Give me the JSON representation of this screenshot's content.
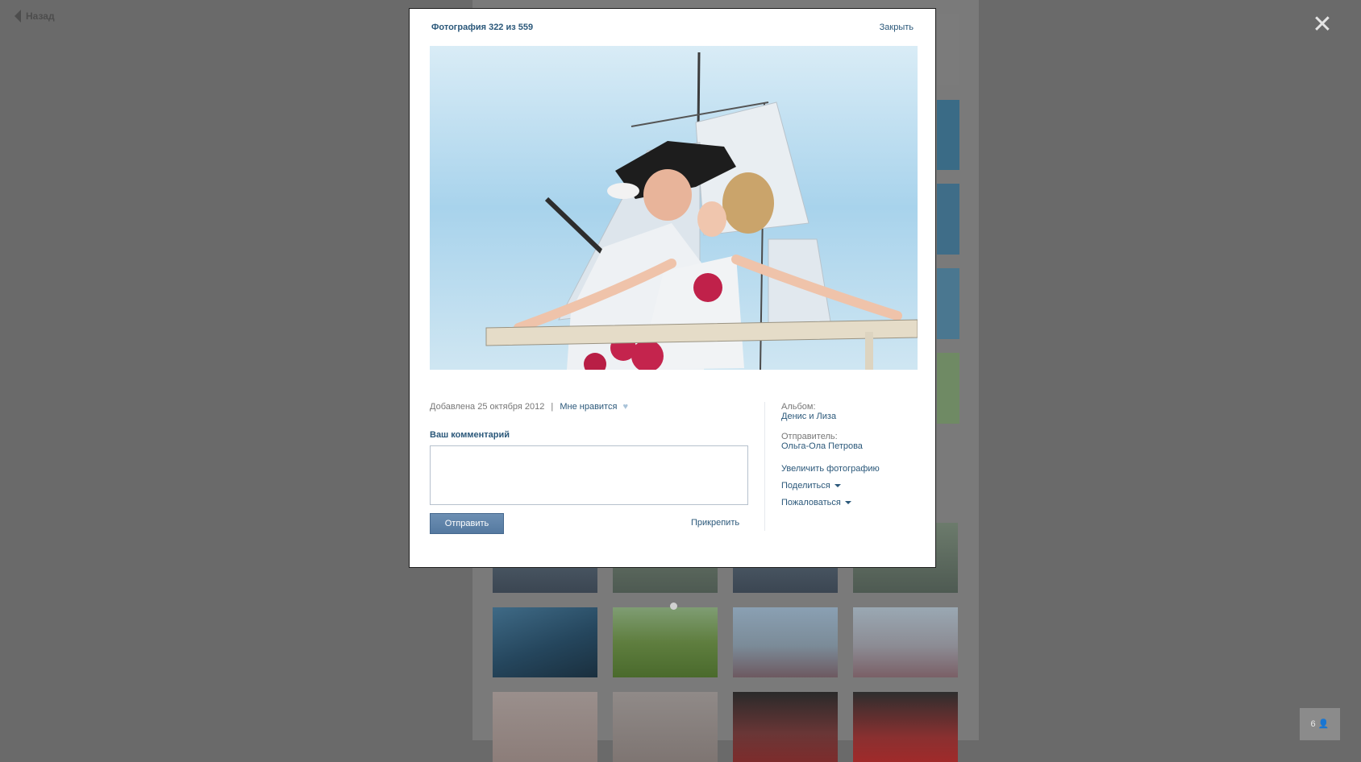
{
  "nav": {
    "back_label": "Назад"
  },
  "modal": {
    "title": "Фотография 322 из 559",
    "close_label": "Закрыть",
    "added_text": "Добавлена 25 октября 2012",
    "like_label": "Мне нравится",
    "comment_title": "Ваш комментарий",
    "send_label": "Отправить",
    "attach_label": "Прикрепить",
    "album_label": "Альбом:",
    "album_name": "Денис и Лиза",
    "sender_label": "Отправитель:",
    "sender_name": "Ольга-Ола Петрова",
    "enlarge_label": "Увеличить фотографию",
    "share_label": "Поделиться",
    "report_label": "Пожаловаться"
  },
  "online_count": "6",
  "icons": {
    "back": "arrow-left-icon",
    "close": "close-icon",
    "heart": "heart-icon",
    "user": "user-icon",
    "caret": "caret-down-icon"
  }
}
